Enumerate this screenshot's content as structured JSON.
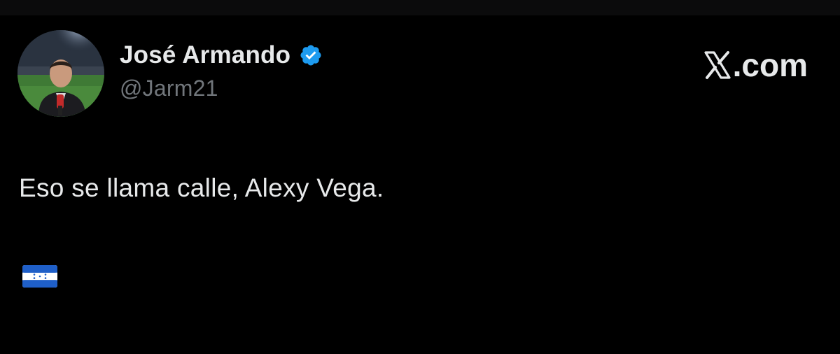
{
  "tweet": {
    "author": {
      "display_name": "José Armando",
      "handle": "@Jarm21",
      "verified": true,
      "avatar": "avatar-photo"
    },
    "brand": {
      "text": ".com",
      "logo_icon": "x-logo-icon"
    },
    "text": "Eso se llama calle, Alexy Vega.",
    "emoji_icon": "honduras-flag-icon"
  },
  "colors": {
    "background": "#000000",
    "primary_text": "#e7e9ea",
    "secondary_text": "#71767b",
    "verified_blue": "#1d9bf0",
    "flag_blue": "#1f5fc8"
  }
}
